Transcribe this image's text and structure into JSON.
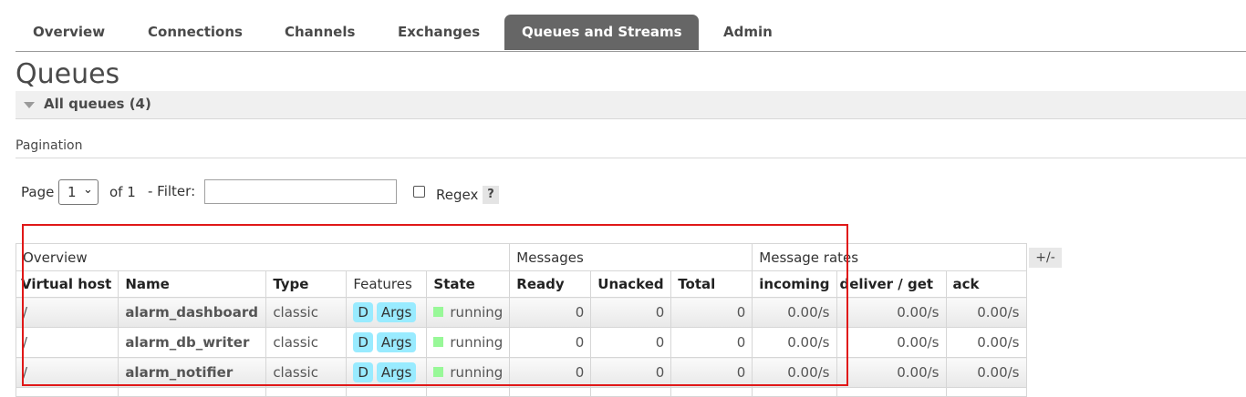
{
  "nav": {
    "tabs": [
      {
        "label": "Overview",
        "active": false
      },
      {
        "label": "Connections",
        "active": false
      },
      {
        "label": "Channels",
        "active": false
      },
      {
        "label": "Exchanges",
        "active": false
      },
      {
        "label": "Queues and Streams",
        "active": true
      },
      {
        "label": "Admin",
        "active": false
      }
    ]
  },
  "page": {
    "title": "Queues",
    "section_label": "All queues (4)",
    "pagination_heading": "Pagination"
  },
  "filter": {
    "page_label": "Page",
    "page_value": "1",
    "of_label": "of 1",
    "filter_label": "- Filter:",
    "filter_value": "",
    "regex_label": "Regex",
    "regex_checked": false,
    "help_label": "?"
  },
  "table": {
    "groups": [
      {
        "label": "Overview",
        "span": 5
      },
      {
        "label": "Messages",
        "span": 3
      },
      {
        "label": "Message rates",
        "span": 3
      }
    ],
    "columns": [
      "Virtual host",
      "Name",
      "Type",
      "Features",
      "State",
      "Ready",
      "Unacked",
      "Total",
      "incoming",
      "deliver / get",
      "ack"
    ],
    "rows": [
      {
        "vhost": "/",
        "name": "alarm_dashboard",
        "type": "classic",
        "features": [
          "D",
          "Args"
        ],
        "state": "running",
        "ready": "0",
        "unacked": "0",
        "total": "0",
        "incoming": "0.00/s",
        "deliver_get": "0.00/s",
        "ack": "0.00/s"
      },
      {
        "vhost": "/",
        "name": "alarm_db_writer",
        "type": "classic",
        "features": [
          "D",
          "Args"
        ],
        "state": "running",
        "ready": "0",
        "unacked": "0",
        "total": "0",
        "incoming": "0.00/s",
        "deliver_get": "0.00/s",
        "ack": "0.00/s"
      },
      {
        "vhost": "/",
        "name": "alarm_notifier",
        "type": "classic",
        "features": [
          "D",
          "Args"
        ],
        "state": "running",
        "ready": "0",
        "unacked": "0",
        "total": "0",
        "incoming": "0.00/s",
        "deliver_get": "0.00/s",
        "ack": "0.00/s"
      }
    ],
    "toggle_columns_label": "+/-"
  },
  "colors": {
    "active_tab_bg": "#666666",
    "feature_badge": "#99ebff",
    "state_running": "#98f898",
    "annotation_box": "#e01818"
  }
}
